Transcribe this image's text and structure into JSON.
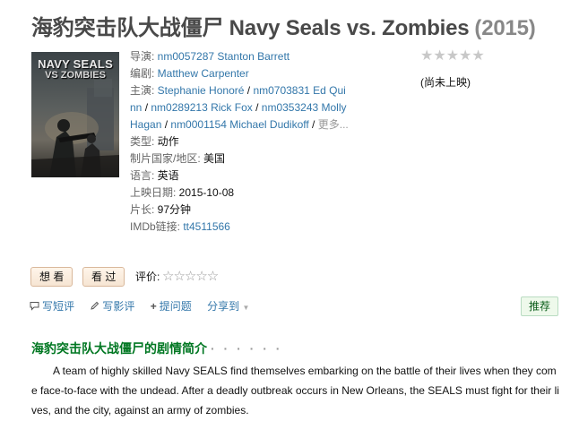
{
  "movie": {
    "title": "海豹突击队大战僵尸 Navy Seals vs. Zombies",
    "year": "(2015)"
  },
  "poster": {
    "line1": "NAVY SEALS",
    "line2": "VS ZOMBIES"
  },
  "info": {
    "director_label": "导演: ",
    "director": "nm0057287 Stanton Barrett",
    "writer_label": "编剧: ",
    "writer": "Matthew Carpenter",
    "cast_label": "主演: ",
    "cast_1": "Stephanie Honoré",
    "cast_2": "nm0703831 Ed Qui",
    "cast_2b": "nn",
    "cast_3": "nm0289213 Rick Fox",
    "cast_4": "nm0353243 Molly",
    "cast_4b": "Hagan",
    "cast_5": "nm0001154 Michael Dudikoff",
    "cast_more": "更多...",
    "separator": " / ",
    "genre_label": "类型: ",
    "genre": "动作",
    "country_label": "制片国家/地区: ",
    "country": "美国",
    "language_label": "语言: ",
    "language": "英语",
    "release_label": "上映日期: ",
    "release": "2015-10-08",
    "runtime_label": "片长: ",
    "runtime": "97分钟",
    "imdb_label": "IMDb链接: ",
    "imdb": "tt4511566"
  },
  "rating": {
    "stars": "★★★★★",
    "note": "(尚未上映)"
  },
  "user_actions": {
    "want_label": "想 看",
    "seen_label": "看 过",
    "rate_label": "评价:",
    "rate_stars": "☆☆☆☆☆"
  },
  "toolbar": {
    "write_review": "写短评",
    "write_long_review": "写影评",
    "ask": "提问题",
    "share": "分享到",
    "share_arrow": "▼",
    "recommend": "推荐"
  },
  "synopsis": {
    "heading": "海豹突击队大战僵尸的剧情简介",
    "dots": "· · · · · ·",
    "text": "A team of highly skilled Navy SEALS find themselves embarking on the battle of their lives when they come face-to-face with the undead. After a deadly outbreak occurs in New Orleans, the SEALS must fight for their lives, and the city, against an army of zombies."
  }
}
